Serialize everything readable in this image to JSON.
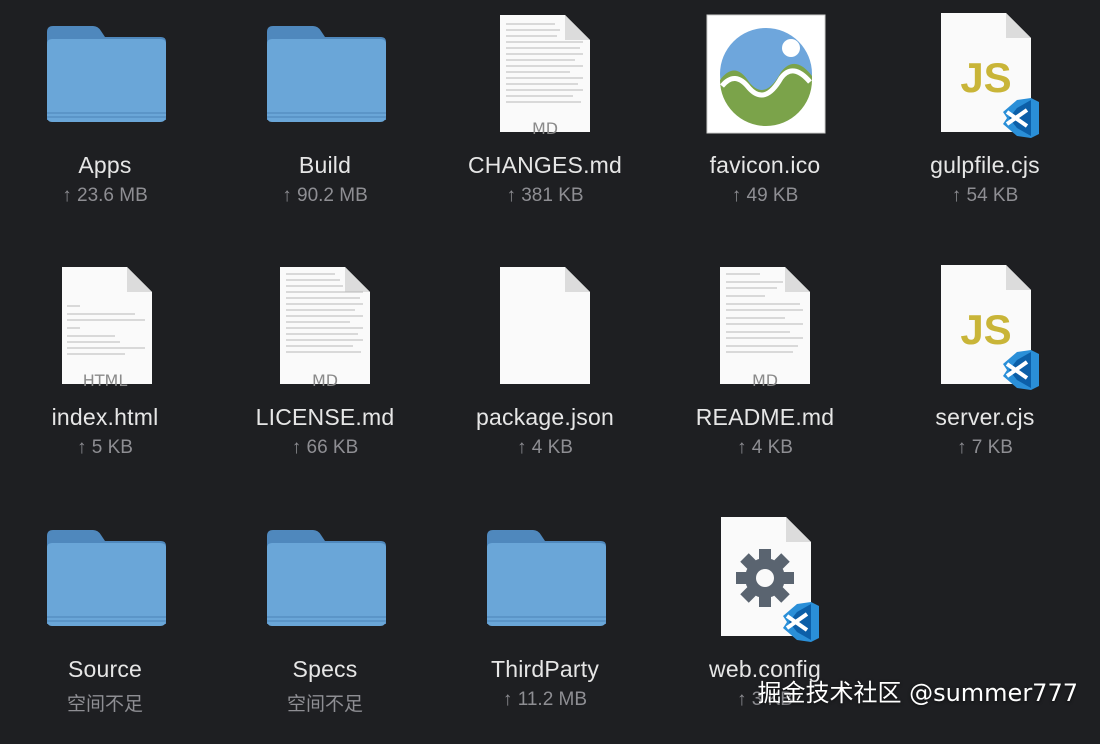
{
  "colors": {
    "background": "#1e1f22",
    "folder": "#6aa6d8",
    "js_text": "#c9b538",
    "vscode_blue": "#2a8fd8",
    "name_text": "#e6e6e6",
    "size_text": "#8e8e93"
  },
  "files": [
    {
      "name": "Apps",
      "size": "↑ 23.6 MB",
      "icon": "folder-icon"
    },
    {
      "name": "Build",
      "size": "↑ 90.2 MB",
      "icon": "folder-icon"
    },
    {
      "name": "CHANGES.md",
      "size": "↑ 381 KB",
      "icon": "markdown-document-icon",
      "badge": "MD"
    },
    {
      "name": "favicon.ico",
      "size": "↑ 49 KB",
      "icon": "image-icon"
    },
    {
      "name": "gulpfile.cjs",
      "size": "↑ 54 KB",
      "icon": "javascript-vscode-icon",
      "badge": "JS"
    },
    {
      "name": "index.html",
      "size": "↑ 5 KB",
      "icon": "html-document-icon",
      "badge": "HTML"
    },
    {
      "name": "LICENSE.md",
      "size": "↑ 66 KB",
      "icon": "markdown-document-icon",
      "badge": "MD"
    },
    {
      "name": "package.json",
      "size": "↑ 4 KB",
      "icon": "blank-document-icon"
    },
    {
      "name": "README.md",
      "size": "↑ 4 KB",
      "icon": "markdown-document-icon",
      "badge": "MD"
    },
    {
      "name": "server.cjs",
      "size": "↑ 7 KB",
      "icon": "javascript-vscode-icon",
      "badge": "JS"
    },
    {
      "name": "Source",
      "size": "空间不足",
      "icon": "folder-icon"
    },
    {
      "name": "Specs",
      "size": "空间不足",
      "icon": "folder-icon"
    },
    {
      "name": "ThirdParty",
      "size": "↑ 11.2 MB",
      "icon": "folder-icon"
    },
    {
      "name": "web.config",
      "size": "↑ 3 KB",
      "icon": "config-vscode-icon"
    }
  ],
  "watermark": "掘金技术社区 @summer777"
}
